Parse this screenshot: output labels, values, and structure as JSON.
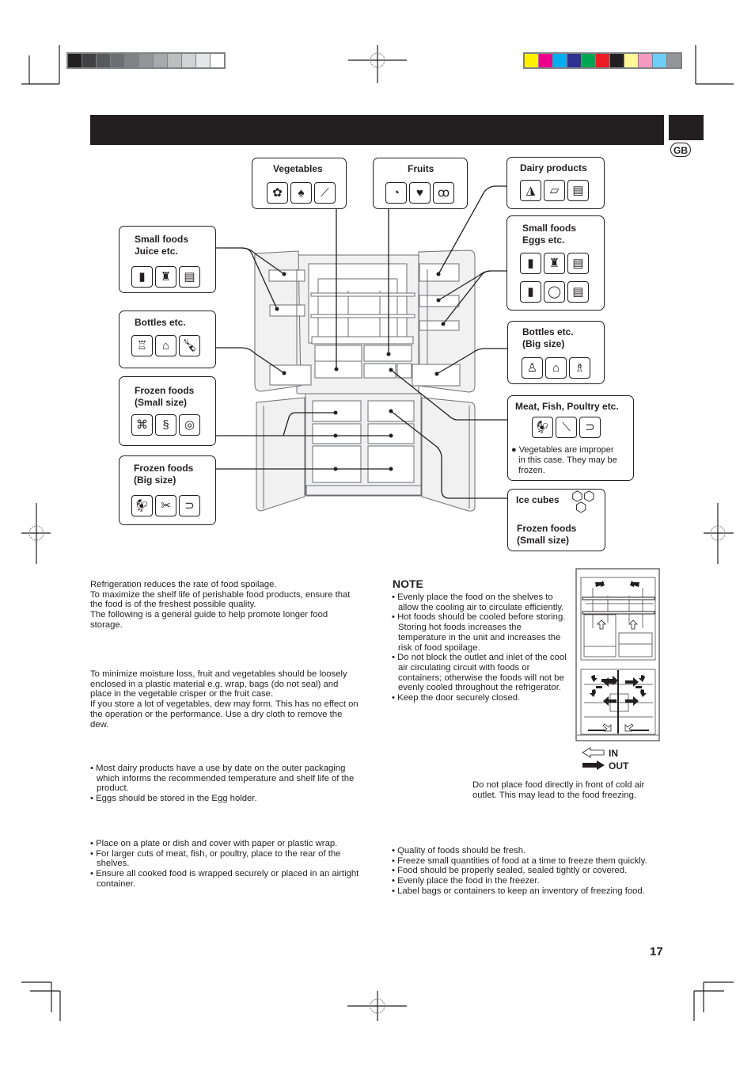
{
  "printer_marks": {
    "grayscale_swatches": [
      "#231f20",
      "#414042",
      "#58595b",
      "#6d6e71",
      "#808285",
      "#939598",
      "#a7a9ac",
      "#bcbec0",
      "#d1d3d4",
      "#e6e7e8",
      "#ffffff"
    ],
    "color_swatches": [
      "#fff200",
      "#ec008c",
      "#00aeef",
      "#2e3192",
      "#00a651",
      "#ed1c24",
      "#231f20",
      "#fff799",
      "#f49ac1",
      "#6dcff6",
      "#939598"
    ]
  },
  "header": {
    "title": "",
    "language_badge": "GB"
  },
  "diagram": {
    "callouts": {
      "vegetables": {
        "title": "Vegetables",
        "icons": [
          "broccoli-icon",
          "pepper-icon",
          "cucumber-icon"
        ]
      },
      "fruits": {
        "title": "Fruits",
        "icons": [
          "orange-slice-icon",
          "strawberry-icon",
          "cherry-icon"
        ]
      },
      "dairy": {
        "title": "Dairy products",
        "icons": [
          "cheese-icon",
          "butter-icon",
          "yogurt-jar-icon"
        ]
      },
      "small_juice": {
        "title": "Small foods\nJuice etc.",
        "icons": [
          "can-icon",
          "juice-bottle-icon",
          "jar-icon"
        ]
      },
      "small_eggs": {
        "title": "Small foods\nEggs etc.",
        "icons": [
          "can-icon",
          "sauce-bottle-icon",
          "jar-icon",
          "can-icon",
          "egg-icon",
          "jar-icon"
        ]
      },
      "bottles": {
        "title": "Bottles etc.",
        "icons": [
          "water-bottle-icon",
          "milk-carton-icon",
          "wine-bottle-icon"
        ]
      },
      "bottles_big": {
        "title": "Bottles etc.\n(Big size)",
        "icons": [
          "jug-icon",
          "milk-carton-icon",
          "wine-bottle-icon"
        ]
      },
      "frozen_small": {
        "title": "Frozen foods\n(Small size)",
        "icons": [
          "chicken-leg-icon",
          "shrimp-icon",
          "fish-cake-icon"
        ]
      },
      "frozen_big": {
        "title": "Frozen foods\n(Big size)",
        "icons": [
          "chicken-icon",
          "lobster-icon",
          "fish-icon"
        ]
      },
      "meat": {
        "title": "Meat, Fish, Poultry etc.",
        "icons": [
          "chicken-icon",
          "drumstick-icon",
          "fish-icon"
        ],
        "note": "● Vegetables are improper\n   in this case. They may be\n   frozen."
      },
      "ice": {
        "title": "Ice cubes",
        "title2": "Frozen foods\n(Small size)",
        "icons": [
          "ice-cubes-icon"
        ]
      }
    }
  },
  "intro": {
    "paragraphs": [
      "Refrigeration reduces the rate of food spoilage.",
      "To maximize the shelf life of perishable food products, ensure that the food is of the freshest possible quality.",
      "The following is a general guide to help promote longer food storage."
    ]
  },
  "fruit_veg": {
    "paragraphs": [
      "To minimize moisture loss, fruit and vegetables should be loosely enclosed in a plastic material e.g. wrap, bags (do not seal) and place in the vegetable crisper or the fruit case.",
      "If you store a lot of vegetables, dew may form. This has no effect on the operation or the performance. Use a dry cloth to remove the dew."
    ]
  },
  "dairy_section": {
    "bullets": [
      "Most dairy products have a use by date on the outer packaging which informs the recommended temperature and shelf life of the product.",
      "Eggs should be stored in the Egg holder."
    ]
  },
  "meat_section": {
    "bullets": [
      "Place on a plate or dish and cover with paper or plastic wrap.",
      "For larger cuts of meat, fish, or poultry, place to the rear of the shelves.",
      "Ensure all cooked food is wrapped securely or placed in an airtight container."
    ]
  },
  "note": {
    "heading": "NOTE",
    "bullets": [
      "Evenly place the food on the shelves to allow the cooling air to circulate efficiently.",
      "Hot foods should be cooled before storing. Storing hot foods increases the temperature in the unit and increases the risk of food spoilage.",
      "Do not block the outlet and inlet of the cool air circulating circuit with foods or containers; otherwise the foods will not be evenly cooled throughout the refrigerator.",
      "Keep the door securely closed."
    ]
  },
  "airflow": {
    "legend_in": "IN",
    "legend_out": "OUT",
    "caption": "Do not place food directly in front of cold air outlet. This may lead to the food freezing."
  },
  "freezer_section": {
    "bullets": [
      "Quality of foods should be fresh.",
      "Freeze small quantities of food at a time to freeze them quickly.",
      "Food should be properly sealed, sealed tightly or covered.",
      "Evenly place the food in the freezer.",
      "Label bags or containers to keep an inventory of freezing food."
    ]
  },
  "footer": {
    "page_number": "17"
  }
}
